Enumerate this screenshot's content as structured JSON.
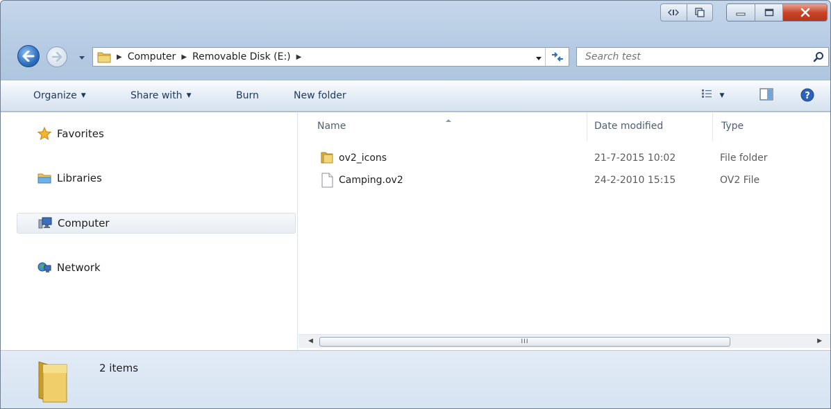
{
  "address": {
    "crumbs": [
      "Computer",
      "Removable Disk (E:)"
    ]
  },
  "search": {
    "placeholder": "Search test"
  },
  "toolbar": {
    "organize": "Organize",
    "share_with": "Share with",
    "burn": "Burn",
    "new_folder": "New folder"
  },
  "nav": {
    "favorites": "Favorites",
    "libraries": "Libraries",
    "computer": "Computer",
    "network": "Network"
  },
  "columns": {
    "name": "Name",
    "date_modified": "Date modified",
    "type": "Type"
  },
  "files": [
    {
      "name": "ov2_icons",
      "date": "21-7-2015 10:02",
      "type": "File folder",
      "icon": "folder-icon"
    },
    {
      "name": "Camping.ov2",
      "date": "24-2-2010 15:15",
      "type": "OV2 File",
      "icon": "file-icon"
    }
  ],
  "scrollbar": {
    "grip": "III"
  },
  "details": {
    "count": "2 items"
  },
  "colors": {
    "chrome": "#b9cde4",
    "accent_blue": "#2e6fc0",
    "close_red": "#c8452a",
    "folder_yellow": "#e8c45a"
  }
}
